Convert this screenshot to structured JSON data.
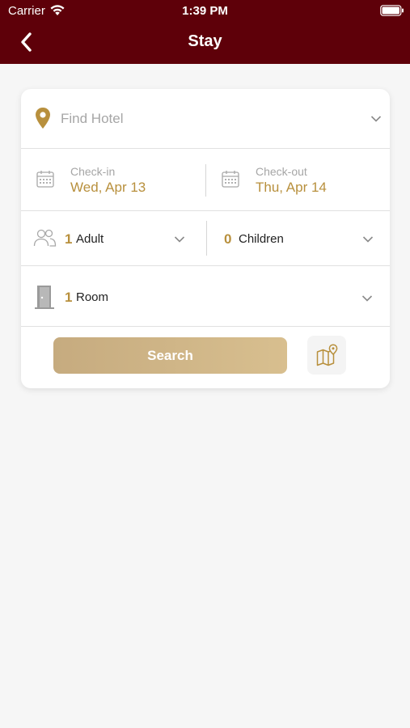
{
  "status_bar": {
    "carrier": "Carrier",
    "time": "1:39 PM"
  },
  "header": {
    "title": "Stay"
  },
  "hotel": {
    "placeholder": "Find Hotel"
  },
  "dates": {
    "checkin_label": "Check-in",
    "checkin_value": "Wed, Apr 13",
    "checkout_label": "Check-out",
    "checkout_value": "Thu, Apr 14"
  },
  "guests": {
    "adults_count": "1",
    "adults_label": "Adult",
    "children_count": "0",
    "children_label": "Children"
  },
  "rooms": {
    "count": "1",
    "label": "Room"
  },
  "actions": {
    "search_label": "Search"
  },
  "colors": {
    "header_bg": "#5e0009",
    "accent_gold": "#b8903d",
    "search_btn": "#d0b585"
  }
}
